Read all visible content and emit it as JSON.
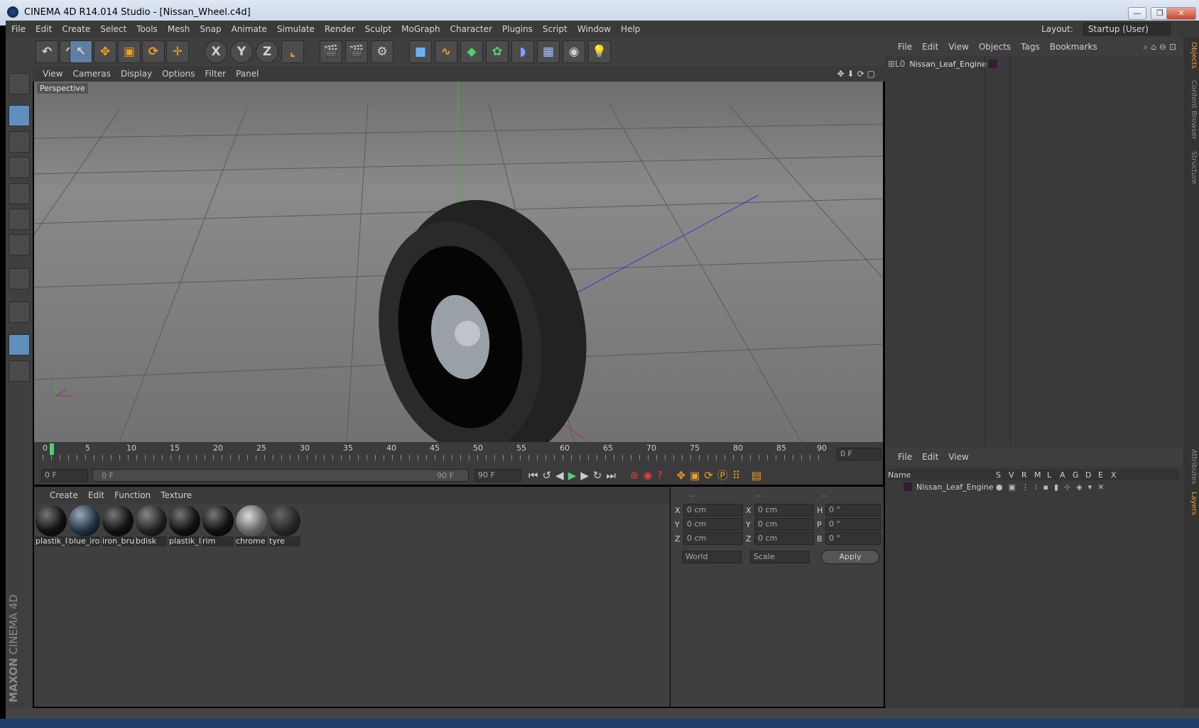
{
  "window": {
    "title": "CINEMA 4D R14.014 Studio - [Nissan_Wheel.c4d]"
  },
  "menubar": [
    "File",
    "Edit",
    "Create",
    "Select",
    "Tools",
    "Mesh",
    "Snap",
    "Animate",
    "Simulate",
    "Render",
    "Sculpt",
    "MoGraph",
    "Character",
    "Plugins",
    "Script",
    "Window",
    "Help"
  ],
  "layout": {
    "label": "Layout:",
    "value": "Startup (User)"
  },
  "toolbar": {
    "x_label": "X",
    "y_label": "Y",
    "z_label": "Z"
  },
  "viewport": {
    "menu": [
      "View",
      "Cameras",
      "Display",
      "Options",
      "Filter",
      "Panel"
    ],
    "camera_label": "Perspective"
  },
  "timeline": {
    "ticks": [
      "0",
      "5",
      "10",
      "15",
      "20",
      "25",
      "30",
      "35",
      "40",
      "45",
      "50",
      "55",
      "60",
      "65",
      "70",
      "75",
      "80",
      "85",
      "90"
    ],
    "current_frame": "0 F",
    "start_field": "0 F",
    "range_start": "0 F",
    "range_end": "90 F",
    "end_field": "90 F"
  },
  "materials": {
    "menu": [
      "Create",
      "Edit",
      "Function",
      "Texture"
    ],
    "items": [
      "plastik_l",
      "blue_iro",
      "iron_bru",
      "bdisk",
      "plastik_l",
      "rim",
      "chrome",
      "tyre"
    ]
  },
  "coordinates": {
    "col_headers": [
      "--",
      "--",
      "--"
    ],
    "rows": [
      {
        "a": "X",
        "av": "0 cm",
        "b": "X",
        "bv": "0 cm",
        "c": "H",
        "cv": "0 °"
      },
      {
        "a": "Y",
        "av": "0 cm",
        "b": "Y",
        "bv": "0 cm",
        "c": "P",
        "cv": "0 °"
      },
      {
        "a": "Z",
        "av": "0 cm",
        "b": "Z",
        "bv": "0 cm",
        "c": "B",
        "cv": "0 °"
      }
    ],
    "world": "World",
    "scale": "Scale",
    "apply": "Apply"
  },
  "objects_panel": {
    "menu": [
      "File",
      "Edit",
      "View",
      "Objects",
      "Tags",
      "Bookmarks"
    ],
    "item": "Nissan_Leaf_Engine"
  },
  "layers_panel": {
    "menu": [
      "File",
      "Edit",
      "View"
    ],
    "columns": [
      "Name",
      "S",
      "V",
      "R",
      "M",
      "L",
      "A",
      "G",
      "D",
      "E",
      "X"
    ],
    "item": "Nissan_Leaf_Engine"
  },
  "side_tabs": [
    "Objects",
    "Content Browser",
    "Structure",
    "Attributes",
    "Layers"
  ],
  "logo": {
    "brand": "MAXON",
    "product": "CINEMA 4D"
  }
}
